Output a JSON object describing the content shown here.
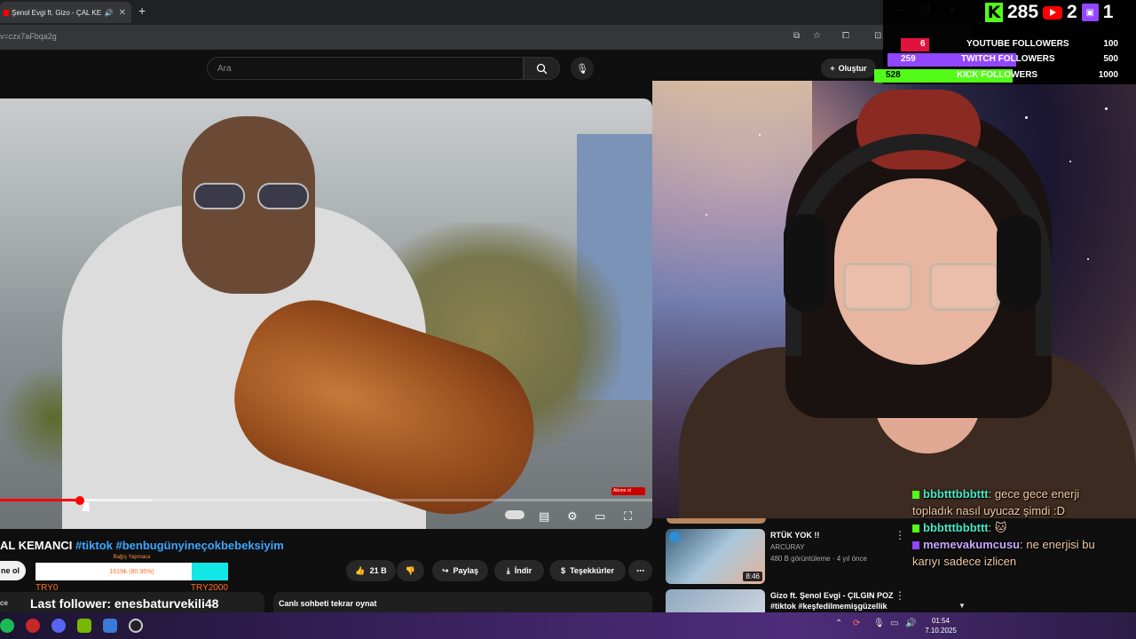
{
  "browser": {
    "tab_title": "Şenol Evgi ft. Gizo - ÇAL KE",
    "url": "v=czx7aFbqa2g"
  },
  "youtube": {
    "search_placeholder": "Ara",
    "create_label": "Oluştur",
    "video": {
      "title_prefix": "AL KEMANCI",
      "title_tags": "#tiktok #benbugünyineçokbebeksiyim",
      "ad_chip": "Abone ol",
      "progress_fraction": 0.123,
      "buffer_fraction": 0.234
    },
    "subscribe_label": "ne ol",
    "actions": {
      "likes": "21 B",
      "share": "Paylaş",
      "download": "İndir",
      "thanks": "Teşekkürler"
    },
    "chat_replay": "Canlı sohbeti tekrar oynat",
    "recommendations": [
      {
        "title": "RTÜK YOK !!",
        "channel": "ARCURAY",
        "meta": "480 B görüntüleme · 4 yıl önce",
        "duration": "8:46"
      },
      {
        "title": "Gizo ft. Şenol Evgi - ÇILGIN POZ #tiktok #keşfedilmemişgüzellik",
        "channel": "",
        "meta": "",
        "duration": ""
      }
    ]
  },
  "donation_goal": {
    "label": "Bağış Yapmaca",
    "amount_text": "1619₺ (80.95%)",
    "fraction": 0.8095,
    "min_label": "TRY0",
    "max_label": "TRY2000"
  },
  "last_follower": {
    "prefix": "ce",
    "text": "Last follower: enesbaturvekili48"
  },
  "follower_goals": {
    "kick_count": "285",
    "youtube_count": "2",
    "twitch_count": "1",
    "rows": [
      {
        "label": "YOUTUBE FOLLOWERS",
        "current": "6",
        "target": "100",
        "fraction": 0.06,
        "color": "#e1123c"
      },
      {
        "label": "TWITCH FOLLOWERS",
        "current": "259",
        "target": "500",
        "fraction": 0.518,
        "color": "#9146ff"
      },
      {
        "label": "KICK FOLLOWERS",
        "current": "528",
        "target": "1000",
        "fraction": 0.528,
        "color": "#53fc18"
      }
    ],
    "colors": {
      "kick": "#53fc18",
      "youtube": "#ff0000",
      "twitch": "#9146ff"
    }
  },
  "chat": [
    {
      "user": "bbbtttbbbttt",
      "message": "gece gece enerji topladık nasıl uyucaz şimdi :D"
    },
    {
      "user": "bbbtttbbbttt",
      "message": "🐱"
    },
    {
      "user": "memevakumcusu",
      "message": "ne enerjisi bu karıyı sadece izlicen"
    }
  ],
  "taskbar": {
    "time": "01:54",
    "date": "7.10.2025",
    "icons": [
      "spotify-icon",
      "app-red-icon",
      "discord-icon",
      "nvidia-icon",
      "app-blue-icon",
      "obs-icon"
    ]
  }
}
